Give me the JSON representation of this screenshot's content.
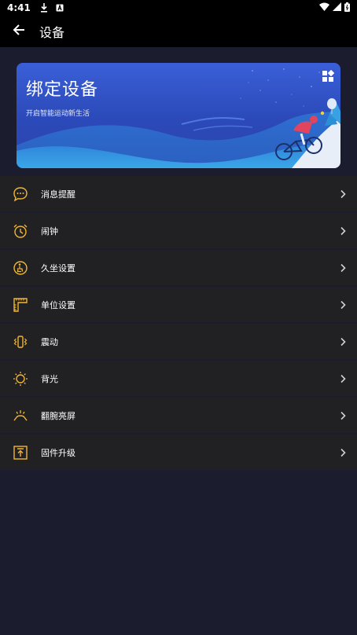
{
  "status_bar": {
    "time": "4:41",
    "icons": [
      "download-icon",
      "notification-a-icon",
      "wifi-icon",
      "signal-icon",
      "battery-icon"
    ]
  },
  "app_bar": {
    "title": "设备",
    "back_icon": "arrow-back-icon"
  },
  "banner": {
    "title": "绑定设备",
    "subtitle": "开启智能运动新生活",
    "menu_icon": "grid-apps-icon"
  },
  "menu": [
    {
      "label": "消息提醒",
      "icon": "message-bubble-icon"
    },
    {
      "label": "闹钟",
      "icon": "alarm-clock-icon"
    },
    {
      "label": "久坐设置",
      "icon": "sedentary-icon"
    },
    {
      "label": "单位设置",
      "icon": "ruler-icon"
    },
    {
      "label": "震动",
      "icon": "vibration-icon"
    },
    {
      "label": "背光",
      "icon": "sun-icon"
    },
    {
      "label": "翻腕亮屏",
      "icon": "wrist-raise-icon"
    },
    {
      "label": "固件升级",
      "icon": "firmware-upgrade-icon"
    }
  ],
  "colors": {
    "background": "#1b1c2e",
    "bar": "#000000",
    "list_item": "#212124",
    "accent_icon": "#f2b632",
    "banner": "#2f52c6"
  }
}
